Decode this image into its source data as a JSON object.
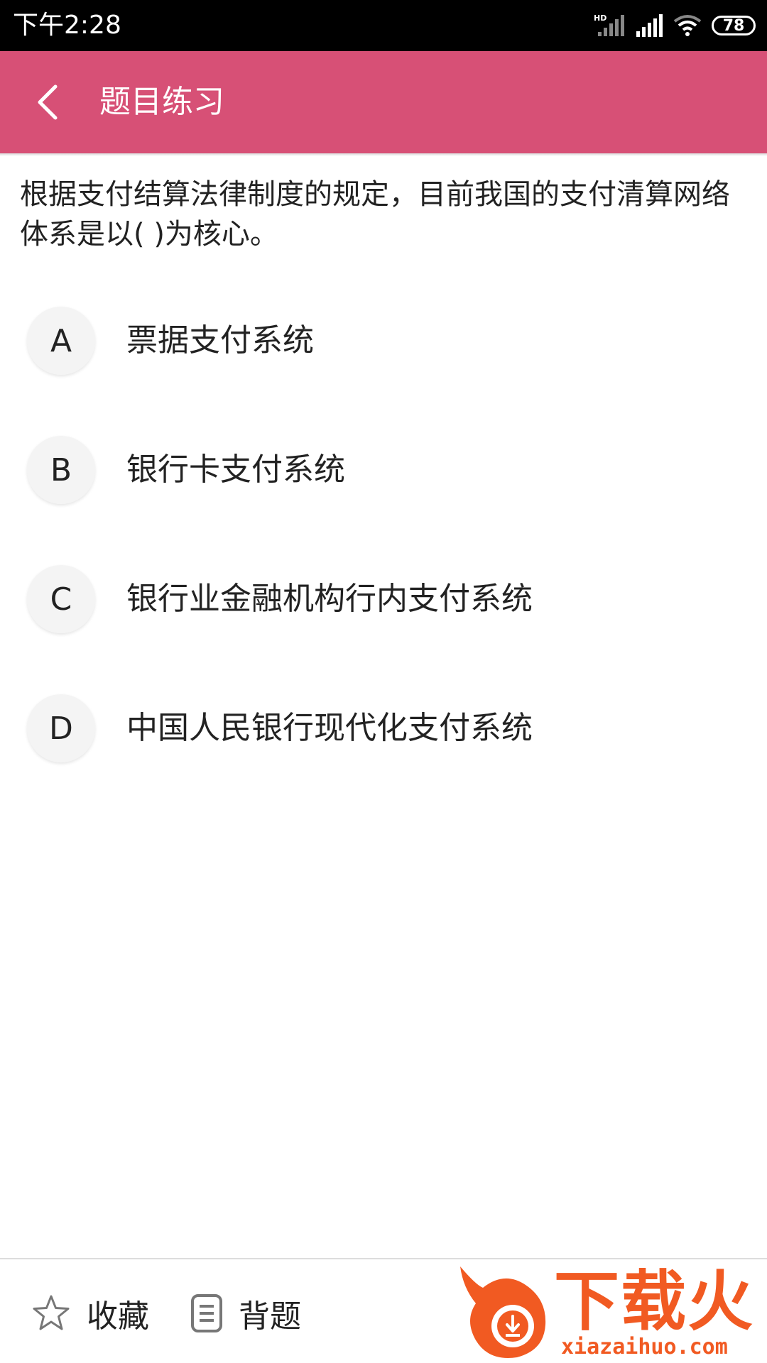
{
  "status_bar": {
    "time": "下午2:28",
    "hd_label": "HD",
    "battery": "78"
  },
  "app_bar": {
    "title": "题目练习",
    "back_icon": "chevron-left-icon",
    "color": "#d75076"
  },
  "question": {
    "text": "根据支付结算法律制度的规定，目前我国的支付清算网络体系是以( )为核心。"
  },
  "options": [
    {
      "letter": "A",
      "text": "票据支付系统"
    },
    {
      "letter": "B",
      "text": "银行卡支付系统"
    },
    {
      "letter": "C",
      "text": "银行业金融机构行内支付系统"
    },
    {
      "letter": "D",
      "text": "中国人民银行现代化支付系统"
    }
  ],
  "bottom_bar": {
    "favorite_label": "收藏",
    "favorite_icon": "star-icon",
    "memorize_label": "背题",
    "memorize_icon": "document-icon"
  },
  "watermark": {
    "title": "下载火",
    "subtitle": "xiazaihuo.com",
    "color": "#f15a22"
  }
}
